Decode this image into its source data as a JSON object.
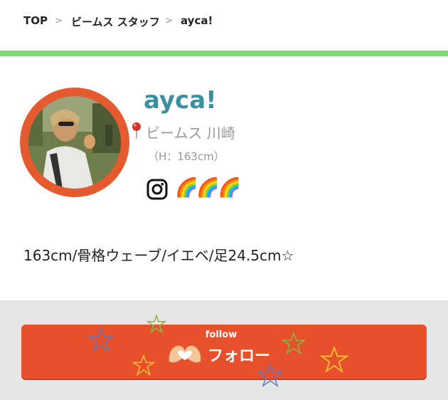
{
  "breadcrumb": {
    "items": [
      "TOP",
      "ビームス スタッフ",
      "ayca!"
    ],
    "separator": ">"
  },
  "profile": {
    "name": "ayca!",
    "shop": "ビームス 川崎",
    "height": "（H：163cm）",
    "rainbows": "🌈🌈🌈",
    "bio": "163cm/骨格ウェーブ/イエベ/足24.5cm☆"
  },
  "follow": {
    "small_label": "follow",
    "main_label": "フォロー"
  },
  "colors": {
    "accent_green": "#7ddc74",
    "name_teal": "#3d8fa0",
    "avatar_ring": "#e55a2e",
    "follow_orange": "#e8502b"
  }
}
